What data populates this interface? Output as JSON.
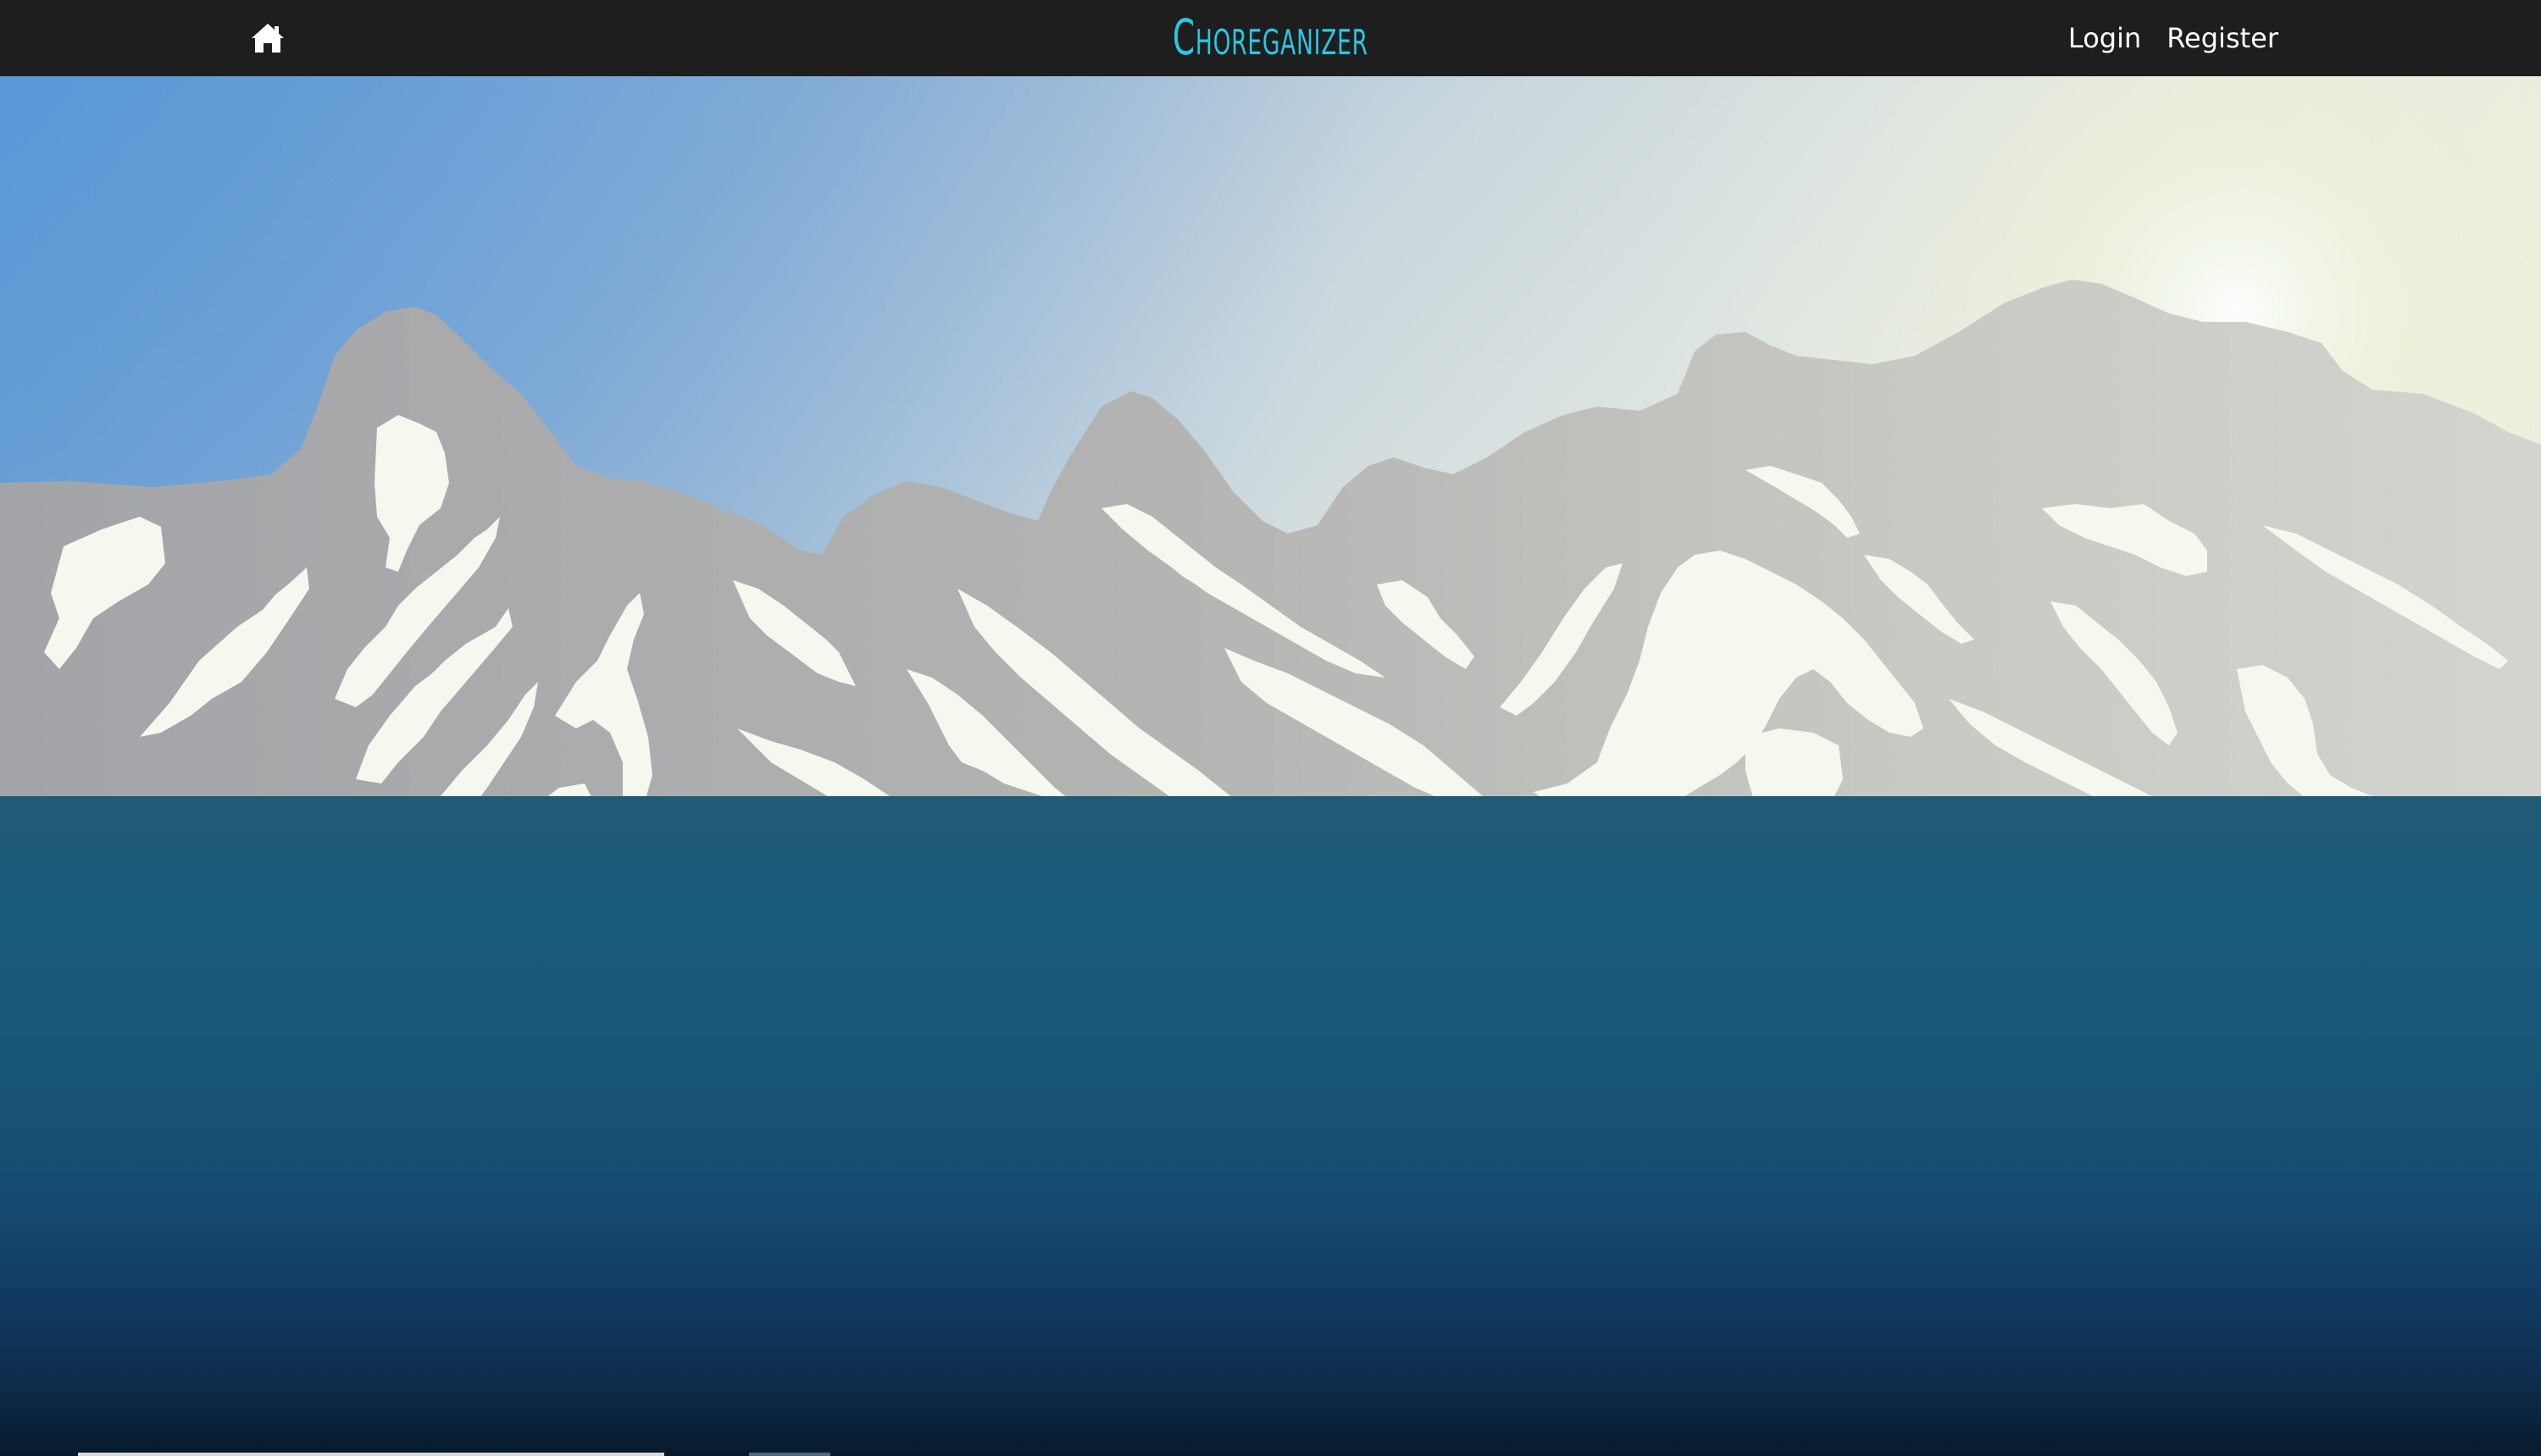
{
  "navbar": {
    "brand": "Choreganizer",
    "home_icon": "home-icon",
    "login_label": "Login",
    "register_label": "Register"
  },
  "colors": {
    "navbar_bg": "#1e1e1e",
    "brand": "#2bc6e2",
    "nav_text": "#ffffff",
    "sea_top": "#215a75",
    "sea_bottom": "#081a2c"
  },
  "hero": {
    "image": "mountain-landscape-illustration"
  }
}
